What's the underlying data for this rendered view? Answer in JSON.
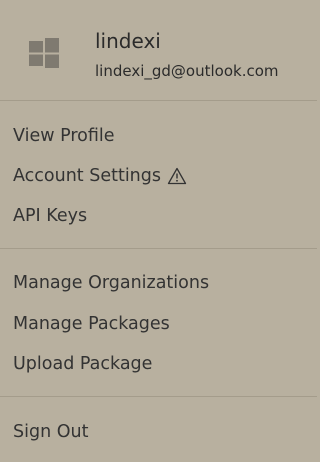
{
  "profile": {
    "avatar_icon": "windows-logo-icon",
    "username": "lindexi",
    "email": "lindexi_gd@outlook.com"
  },
  "menu": {
    "groups": [
      {
        "items": [
          {
            "label": "View Profile"
          },
          {
            "label": "Account Settings",
            "icon": "warning-icon"
          },
          {
            "label": "API Keys"
          }
        ]
      },
      {
        "items": [
          {
            "label": "Manage Organizations"
          },
          {
            "label": "Manage Packages"
          },
          {
            "label": "Upload Package"
          }
        ]
      },
      {
        "items": [
          {
            "label": "Sign Out"
          }
        ]
      }
    ]
  },
  "colors": {
    "background": "#b8b09f",
    "divider": "#a49c8b",
    "text": "#333333"
  }
}
